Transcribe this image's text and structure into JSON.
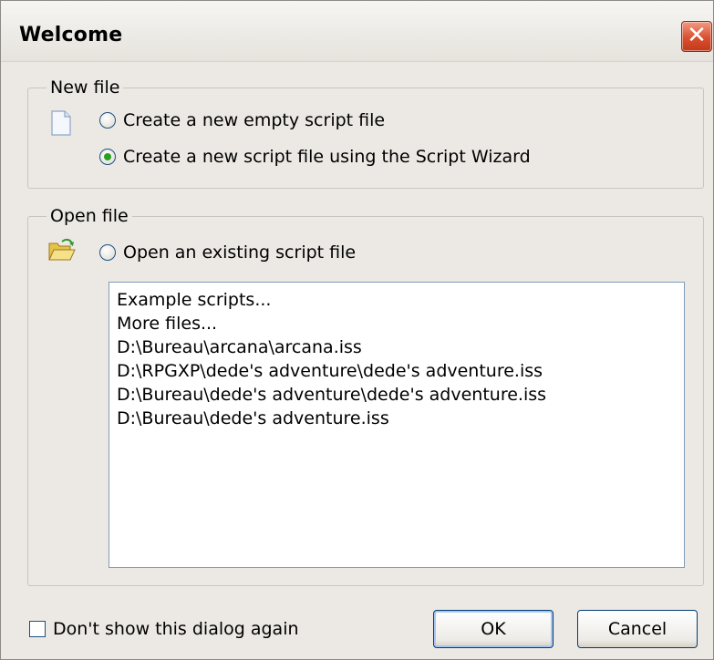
{
  "window": {
    "title": "Welcome",
    "close_glyph": "✕"
  },
  "new_file": {
    "group_label": "New file",
    "icon": "document-icon",
    "options": [
      {
        "label": "Create a new empty script file",
        "checked": false
      },
      {
        "label": "Create a new script file using the Script Wizard",
        "checked": true
      }
    ]
  },
  "open_file": {
    "group_label": "Open file",
    "icon": "open-folder-icon",
    "option_label": "Open an existing script file",
    "option_checked": false,
    "recent_files": [
      "Example scripts...",
      "More files...",
      "D:\\Bureau\\arcana\\arcana.iss",
      "D:\\RPGXP\\dede's adventure\\dede's adventure.iss",
      "D:\\Bureau\\dede's adventure\\dede's adventure.iss",
      "D:\\Bureau\\dede's adventure.iss"
    ]
  },
  "footer": {
    "dont_show_label": "Don't show this dialog again",
    "dont_show_checked": false,
    "ok_label": "OK",
    "cancel_label": "Cancel"
  },
  "colors": {
    "window_bg": "#ece9e4",
    "close_button": "#d8502f",
    "radio_selected": "#27a11f",
    "list_border": "#7f9db9"
  }
}
